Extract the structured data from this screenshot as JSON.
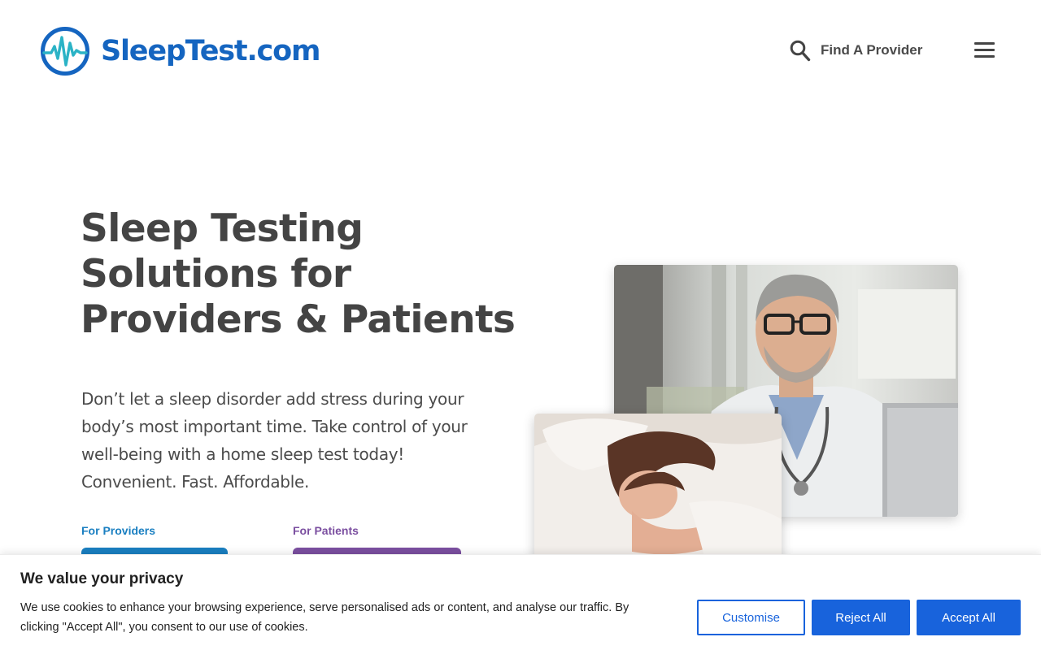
{
  "header": {
    "logo_text": "SleepTest.com",
    "find_provider_label": "Find A Provider",
    "brand_color": "#1565c0"
  },
  "hero": {
    "title_line1": "Sleep Testing",
    "title_line2": "Solutions for",
    "title_line3": "Providers & Patients",
    "text_line1": "Don’t let a sleep disorder add stress during your",
    "text_line2": "body’s most important time. Take control of your",
    "text_line3": "well-being with a home sleep test today!",
    "text_line4": "Convenient. Fast. Affordable.",
    "providers_label": "For Providers",
    "patients_label": "For Patients",
    "providers_color": "#1a7fc1",
    "patients_color": "#7b4fa0"
  },
  "cookie_banner": {
    "title": "We value your privacy",
    "text_line1": "We use cookies to enhance your browsing experience, serve personalised ads or content, and analyse our traffic. By",
    "text_line2": "clicking \"Accept All\", you consent to our use of cookies.",
    "customise_label": "Customise",
    "reject_label": "Reject All",
    "accept_label": "Accept All",
    "accent_color": "#1863dc"
  }
}
